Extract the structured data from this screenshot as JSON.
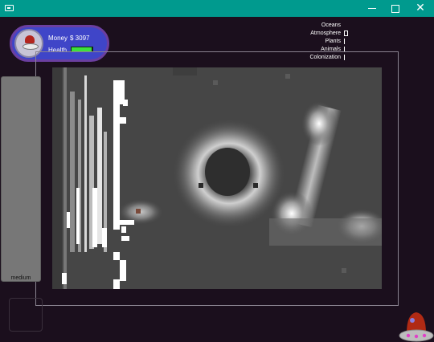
{
  "window": {
    "controls": {
      "minimize": "minimize-icon",
      "maximize": "maximize-icon",
      "close": "close-icon"
    }
  },
  "player": {
    "money_label": "Money",
    "money_value": "$ 3097",
    "health_label": "Health",
    "health_level": 0.95,
    "avatar_icon": "gnome-avatar-icon"
  },
  "stats": [
    {
      "label": "Oceans"
    },
    {
      "label": "Atmosphere"
    },
    {
      "label": "Plants"
    },
    {
      "label": "Animals"
    },
    {
      "label": "Colonization"
    }
  ],
  "side_panel": {
    "label": "medium"
  },
  "colors": {
    "titlebar": "#009a8e",
    "background": "#1b0f1d",
    "player_panel": "#3f45c8",
    "health": "#3de03d"
  }
}
